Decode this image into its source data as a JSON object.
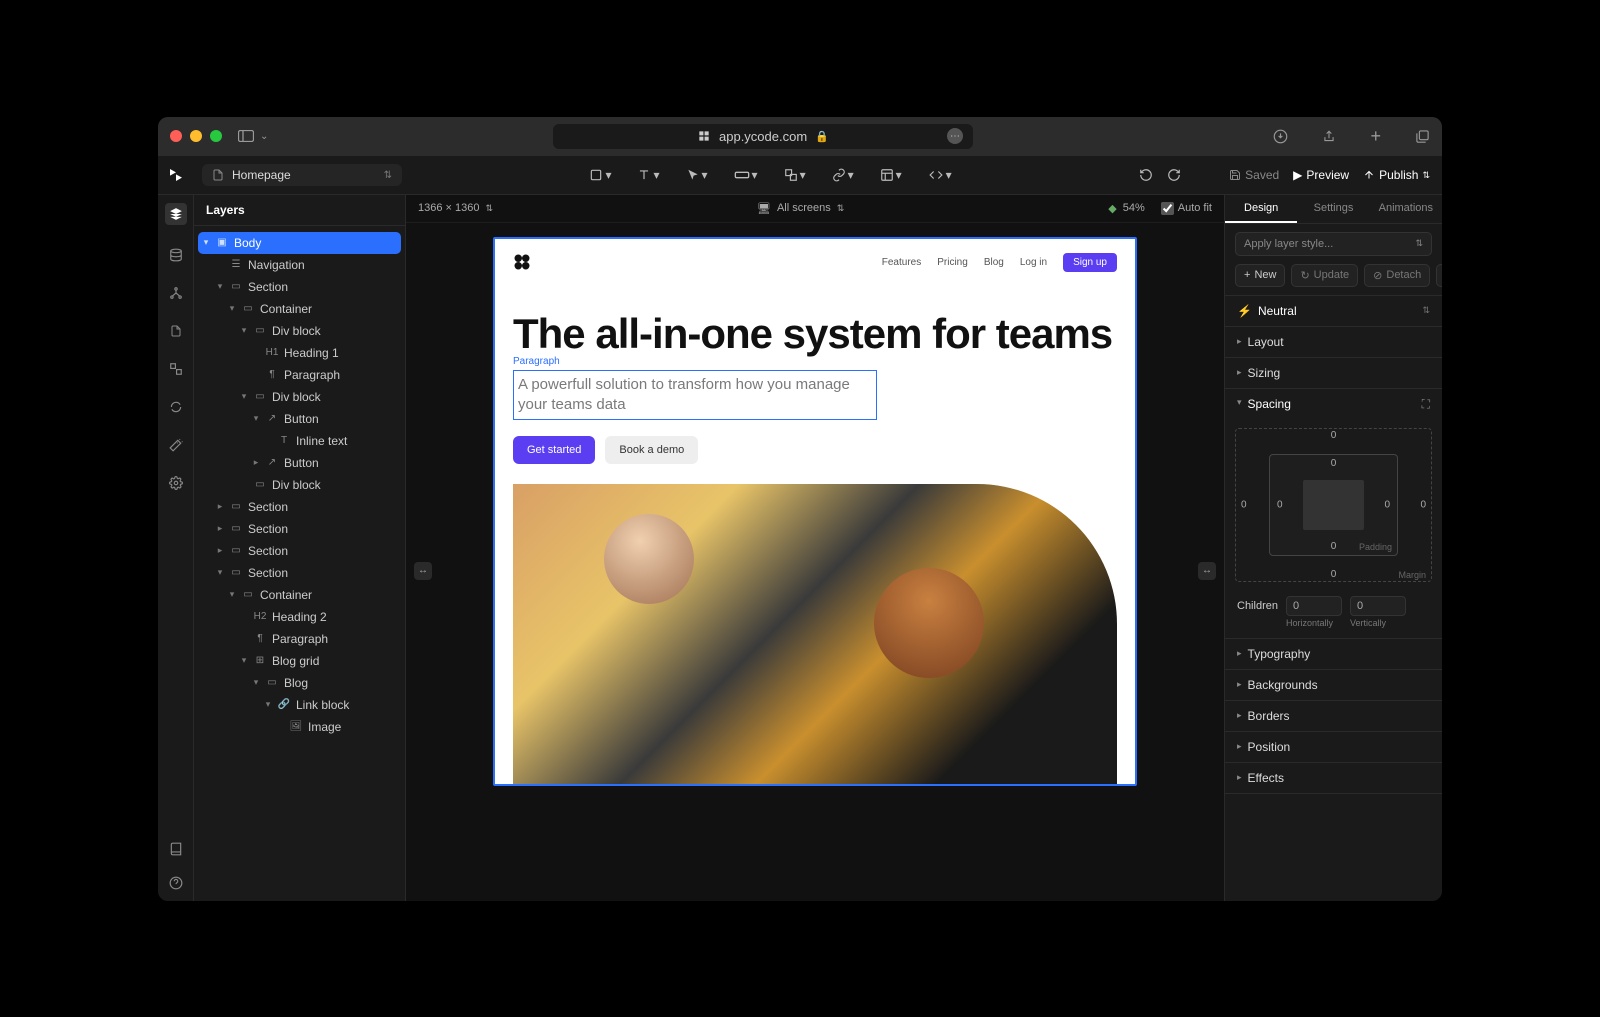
{
  "browser": {
    "url": "app.ycode.com"
  },
  "file": {
    "name": "Homepage"
  },
  "toolbar": {
    "saved": "Saved",
    "preview": "Preview",
    "publish": "Publish"
  },
  "canvas": {
    "dimensions": "1366 × 1360",
    "breakpoint": "All screens",
    "zoom": "54%",
    "autofit": "Auto fit"
  },
  "leftpanel": {
    "title": "Layers"
  },
  "tree": {
    "body": "Body",
    "navigation": "Navigation",
    "section1": "Section",
    "container1": "Container",
    "divblock1": "Div block",
    "heading1": "Heading 1",
    "paragraph1": "Paragraph",
    "divblock2": "Div block",
    "button1": "Button",
    "inlinetext": "Inline text",
    "button2": "Button",
    "divblock3": "Div block",
    "section2": "Section",
    "section3": "Section",
    "section4": "Section",
    "section5": "Section",
    "container2": "Container",
    "heading2": "Heading 2",
    "paragraph2": "Paragraph",
    "bloggrid": "Blog grid",
    "blog": "Blog",
    "linkblock": "Link block",
    "image": "Image"
  },
  "page": {
    "nav": {
      "features": "Features",
      "pricing": "Pricing",
      "blog": "Blog",
      "login": "Log in",
      "signup": "Sign up"
    },
    "hero": {
      "heading": "The all-in-one system for teams",
      "sel_label": "Paragraph",
      "paragraph": "A powerfull solution to transform how you manage your teams data",
      "cta1": "Get started",
      "cta2": "Book a demo"
    }
  },
  "right": {
    "tabs": {
      "design": "Design",
      "settings": "Settings",
      "animations": "Animations"
    },
    "style_placeholder": "Apply layer style...",
    "new": "New",
    "update": "Update",
    "detach": "Detach",
    "neutral": "Neutral",
    "sections": {
      "layout": "Layout",
      "sizing": "Sizing",
      "spacing": "Spacing",
      "typography": "Typography",
      "backgrounds": "Backgrounds",
      "borders": "Borders",
      "position": "Position",
      "effects": "Effects"
    },
    "spacing": {
      "margin": {
        "top": "0",
        "right": "0",
        "bottom": "0",
        "left": "0",
        "label": "Margin"
      },
      "padding": {
        "top": "0",
        "right": "0",
        "bottom": "0",
        "left": "0",
        "label": "Padding"
      }
    },
    "children": {
      "label": "Children",
      "horizontal": "0",
      "vertical": "0",
      "hlabel": "Horizontally",
      "vlabel": "Vertically"
    }
  }
}
